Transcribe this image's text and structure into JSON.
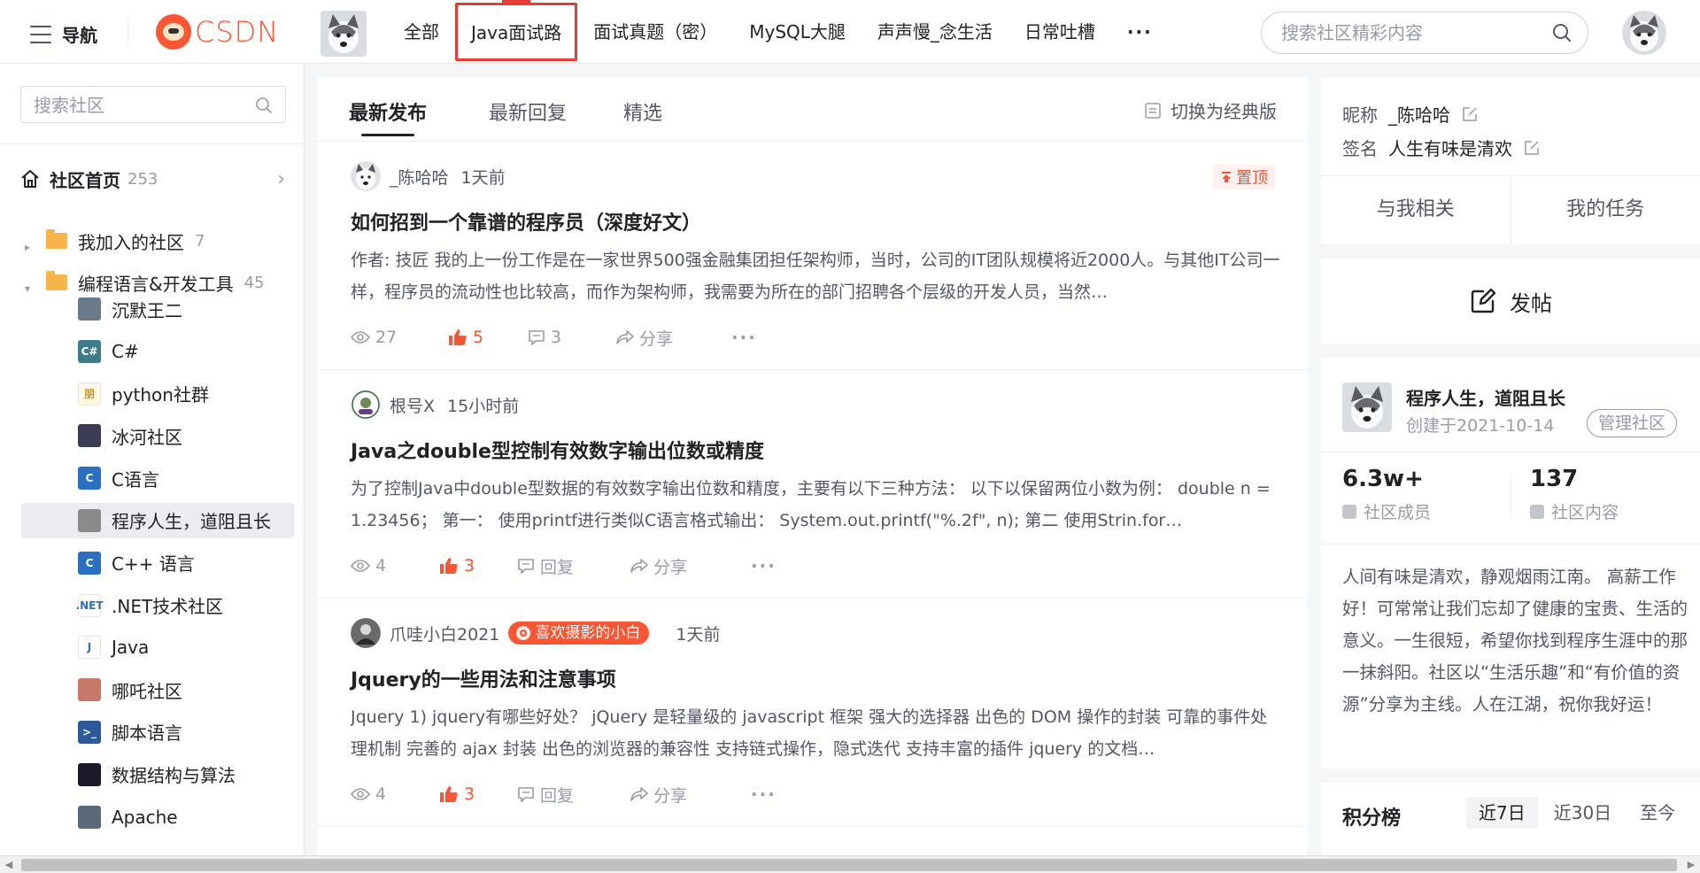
{
  "nav": {
    "label": "导航"
  },
  "logo": {
    "text": "CSDN"
  },
  "top_tabs": [
    "全部",
    "Java面试路",
    "面试真题（密）",
    "MySQL大腿",
    "声声慢_念生活",
    "日常吐槽",
    "···"
  ],
  "search": {
    "placeholder": "搜索社区精彩内容"
  },
  "sidebar": {
    "search_placeholder": "搜索社区",
    "home": {
      "label": "社区首页",
      "count": "253"
    },
    "groups": [
      {
        "label": "我加入的社区",
        "count": "7",
        "caret": "▸"
      },
      {
        "label": "编程语言&开发工具",
        "count": "45",
        "caret": "▾"
      }
    ],
    "communities": [
      {
        "label": "沉默王二",
        "icon_text": "",
        "color": "#6b7a8a"
      },
      {
        "label": "C#",
        "icon_text": "C#",
        "color": "#3d7d8a"
      },
      {
        "label": "python社群",
        "icon_text": "朋",
        "color": "#f3d78a"
      },
      {
        "label": "冰河社区",
        "icon_text": "",
        "color": "#3b3b55"
      },
      {
        "label": "C语言",
        "icon_text": "C",
        "color": "#2b6fc1"
      },
      {
        "label": "程序人生，道阻且长",
        "icon_text": "",
        "color": "#8a8a8a"
      },
      {
        "label": "C++ 语言",
        "icon_text": "C",
        "color": "#2b6fc1"
      },
      {
        "label": ".NET技术社区",
        "icon_text": ".NET",
        "color": "#ffffff"
      },
      {
        "label": "Java",
        "icon_text": "J",
        "color": "#ffffff"
      },
      {
        "label": "哪吒社区",
        "icon_text": "",
        "color": "#c77a6a"
      },
      {
        "label": "脚本语言",
        "icon_text": ">_",
        "color": "#2b5a9a"
      },
      {
        "label": "数据结构与算法",
        "icon_text": "",
        "color": "#1a1a2a"
      },
      {
        "label": "Apache",
        "icon_text": "",
        "color": "#5a6a7a"
      }
    ]
  },
  "feed": {
    "tabs": [
      "最新发布",
      "最新回复",
      "精选"
    ],
    "switch_label": "切换为经典版",
    "posts": [
      {
        "author": "_陈哈哈",
        "time": "1天前",
        "pinned": "置顶",
        "badge": "",
        "title": "如何招到一个靠谱的程序员（深度好文）",
        "excerpt": "作者: 技匠 我的上一份工作是在一家世界500强金融集团担任架构师，当时，公司的IT团队规模将近2000人。与其他IT公司一样，程序员的流动性也比较高，而作为架构师，我需要为所在的部门招聘各个层级的开发人员，当然…",
        "views": "27",
        "likes": "5",
        "replies": "3",
        "reply_label": "",
        "share": "分享"
      },
      {
        "author": "根号X",
        "time": "15小时前",
        "pinned": "",
        "badge": "",
        "title": "Java之double型控制有效数字输出位数或精度",
        "excerpt": "为了控制Java中double型数据的有效数字输出位数和精度，主要有以下三种方法： 以下以保留两位小数为例： double n = 1.23456； 第一： 使用printf进行类似C语言格式输出： System.out.printf(\"%.2f\", n); 第二 使用Strin.for…",
        "views": "4",
        "likes": "3",
        "replies": "",
        "reply_label": "回复",
        "share": "分享"
      },
      {
        "author": "爪哇小白2021",
        "time": "1天前",
        "pinned": "",
        "badge": "喜欢摄影的小白",
        "title": "Jquery的一些用法和注意事项",
        "excerpt": "Jquery 1) jquery有哪些好处？ jQuery 是轻量级的 javascript 框架 强大的选择器 出色的 DOM 操作的封装 可靠的事件处理机制 完善的 ajax 封装 出色的浏览器的兼容性 支持链式操作，隐式迭代 支持丰富的插件 jquery 的文档…",
        "views": "4",
        "likes": "3",
        "replies": "",
        "reply_label": "回复",
        "share": "分享"
      }
    ]
  },
  "profile": {
    "nick_label": "昵称",
    "nick": "_陈哈哈",
    "sign_label": "签名",
    "sign": "人生有味是清欢",
    "tab_related": "与我相关",
    "tab_tasks": "我的任务"
  },
  "post_button": "发帖",
  "community": {
    "name": "程序人生，道阻且长",
    "created": "创建于2021-10-14",
    "manage": "管理社区",
    "members_value": "6.3w+",
    "members_label": "社区成员",
    "content_value": "137",
    "content_label": "社区内容",
    "description": "人间有味是清欢，静观烟雨江南。 高薪工作好！可常常让我们忘却了健康的宝贵、生活的意义。一生很短，希望你找到程序生涯中的那一抹斜阳。社区以“生活乐趣”和“有价值的资源”分享为主线。人在江湖，祝你我好运！"
  },
  "rank": {
    "title": "积分榜",
    "tabs": [
      "近7日",
      "近30日",
      "至今"
    ]
  },
  "colors": {
    "brand": "#fc5531",
    "highlight_box": "#e33e33"
  }
}
